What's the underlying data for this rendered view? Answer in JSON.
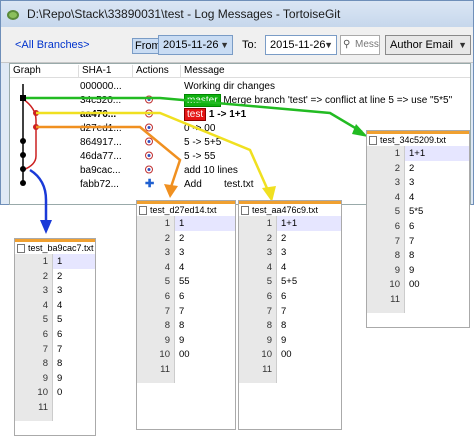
{
  "window": {
    "title": "D:\\Repo\\Stack\\33890031\\test - Log Messages - TortoiseGit",
    "toolbar": {
      "all_branches": "<All Branches>",
      "from_label": "From:",
      "from_value": "2015-11-26",
      "to_label": "To:",
      "to_value": "2015-11-26",
      "search_placeholder": "Messag",
      "author_select": "Author Email"
    },
    "columns": [
      "Graph",
      "SHA-1",
      "Actions",
      "Message"
    ],
    "rows": [
      {
        "sha": "000000...",
        "message": "Working dir changes"
      },
      {
        "sha": "34c520...",
        "ref": "master",
        "message": "Merge branch 'test' => conflict at line 5 => use \"5*5\""
      },
      {
        "sha": "aa476...",
        "ref": "test",
        "message": "1 -> 1+1"
      },
      {
        "sha": "d27ed1...",
        "message": "0 -> 00"
      },
      {
        "sha": "864917...",
        "message": "5 -> 5+5"
      },
      {
        "sha": "46da77...",
        "message": "5 -> 55"
      },
      {
        "sha": "ba9cac...",
        "message": "add 10 lines"
      },
      {
        "sha": "fabb72...",
        "message": "Add        test.txt"
      }
    ]
  },
  "files": [
    {
      "name": "test_34c5209.txt",
      "numbers": [
        "1",
        "2",
        "3",
        "4",
        "5",
        "6",
        "7",
        "8",
        "9",
        "10",
        "11"
      ],
      "lines": [
        "1+1",
        "2",
        "3",
        "4",
        "5*5",
        "6",
        "7",
        "8",
        "9",
        "00",
        ""
      ]
    },
    {
      "name": "test_d27ed14.txt",
      "numbers": [
        "1",
        "2",
        "3",
        "4",
        "5",
        "6",
        "7",
        "8",
        "9",
        "10",
        "11"
      ],
      "lines": [
        "1",
        "2",
        "3",
        "4",
        "55",
        "6",
        "7",
        "8",
        "9",
        "00",
        ""
      ]
    },
    {
      "name": "test_aa476c9.txt",
      "numbers": [
        "1",
        "2",
        "3",
        "4",
        "5",
        "6",
        "7",
        "8",
        "9",
        "10",
        "11"
      ],
      "lines": [
        "1+1",
        "2",
        "3",
        "4",
        "5+5",
        "6",
        "7",
        "8",
        "9",
        "00",
        ""
      ]
    },
    {
      "name": "test_ba9cac7.txt",
      "numbers": [
        "1",
        "2",
        "3",
        "4",
        "5",
        "6",
        "7",
        "8",
        "9",
        "10",
        "11"
      ],
      "lines": [
        "1",
        "2",
        "3",
        "4",
        "5",
        "6",
        "7",
        "8",
        "9",
        "0",
        ""
      ]
    }
  ],
  "colors": {
    "arrow_green": "#22bb22",
    "arrow_yellow": "#f0e020",
    "arrow_orange": "#f09020",
    "arrow_blue": "#1a3ad8",
    "branch_red": "#cc2020"
  }
}
